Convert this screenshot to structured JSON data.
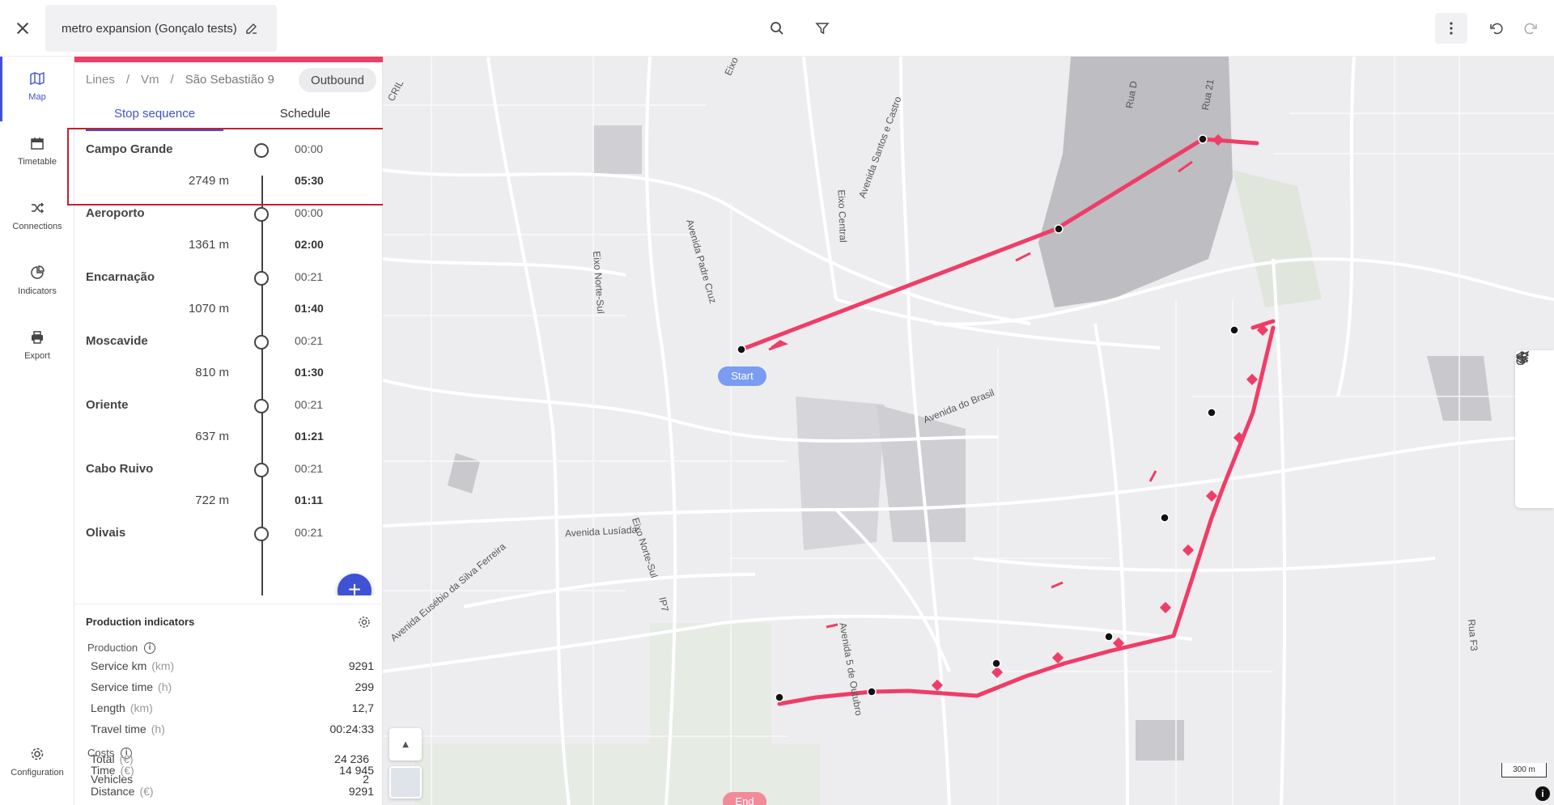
{
  "app": {
    "title": "metro expansion (Gonçalo tests)"
  },
  "topbar": {
    "icons": [
      "close-icon",
      "edit-icon",
      "search-icon",
      "filter-icon",
      "more-vertical-icon",
      "undo-icon",
      "redo-icon"
    ]
  },
  "nav": {
    "items": [
      {
        "label": "Map",
        "icon": "map-icon"
      },
      {
        "label": "Timetable",
        "icon": "calendar-icon"
      },
      {
        "label": "Connections",
        "icon": "shuffle-icon"
      },
      {
        "label": "Indicators",
        "icon": "chart-icon"
      },
      {
        "label": "Export",
        "icon": "printer-icon"
      }
    ],
    "config_label": "Configuration"
  },
  "panel": {
    "breadcrumb": [
      "Lines",
      "Vm",
      "São Sebastião 9"
    ],
    "direction": "Outbound",
    "tabs": [
      "Stop sequence",
      "Schedule"
    ],
    "stops": [
      {
        "name": "Campo Grande",
        "dwell": "00:00",
        "distance": "2749  m",
        "travel": "05:30"
      },
      {
        "name": "Aeroporto",
        "dwell": "00:00",
        "distance": "1361  m",
        "travel": "02:00"
      },
      {
        "name": "Encarnação",
        "dwell": "00:21",
        "distance": "1070  m",
        "travel": "01:40"
      },
      {
        "name": "Moscavide",
        "dwell": "00:21",
        "distance": "810  m",
        "travel": "01:30"
      },
      {
        "name": "Oriente",
        "dwell": "00:21",
        "distance": "637  m",
        "travel": "01:21"
      },
      {
        "name": "Cabo Ruivo",
        "dwell": "00:21",
        "distance": "722  m",
        "travel": "01:11"
      },
      {
        "name": "Olivais",
        "dwell": "00:21",
        "distance": "",
        "travel": ""
      }
    ],
    "add_label": "+"
  },
  "production": {
    "title": "Production indicators",
    "production_section": "Production",
    "costs_section": "Costs",
    "rows": [
      {
        "label": "Service km",
        "unit": "(km)",
        "value": "9291"
      },
      {
        "label": "Service time",
        "unit": "(h)",
        "value": "299"
      },
      {
        "label": "Length",
        "unit": "(km)",
        "value": "12,7"
      },
      {
        "label": "Travel time",
        "unit": "(h)",
        "value": "00:24:33"
      }
    ],
    "cost_rows": [
      {
        "label": "Time",
        "unit": "(€)",
        "value": "14 945"
      },
      {
        "label": "Distance",
        "unit": "(€)",
        "value": "9291"
      },
      {
        "label": "Total",
        "unit": "(€)",
        "value": "24 236"
      },
      {
        "label": "Vehicles",
        "unit": "",
        "value": "2"
      }
    ]
  },
  "map": {
    "start_label": "Start",
    "end_label": "End",
    "scale_label": "300 m",
    "info_label": "i",
    "compass_label": "▲",
    "route_color": "#ef3d68",
    "streets": [
      "Avenida Padre Cruz",
      "Eixo Norte-Sul",
      "Eixo Central",
      "Avenida Santos e Castro",
      "Avenida do Brasil",
      "Avenida Lusíada",
      "Avenida 5 de Outubro",
      "Avenida Eusébio da Silva Ferreira",
      "Eixo Norte-Sul",
      "IP7",
      "CRIL",
      "Rua D",
      "Rua 21",
      "Rua F3",
      "Eixo"
    ]
  }
}
